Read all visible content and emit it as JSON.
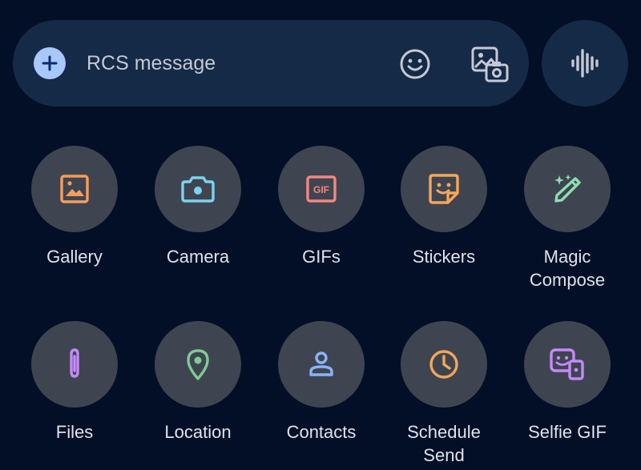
{
  "compose": {
    "placeholder": "RCS message",
    "icons": [
      "plus-icon",
      "emoji-icon",
      "image-camera-icon",
      "voice-waveform-icon"
    ]
  },
  "attachments": {
    "row1": [
      {
        "label": "Gallery",
        "icon": "gallery-icon",
        "color": "#f59e5b"
      },
      {
        "label": "Camera",
        "icon": "camera-icon",
        "color": "#7ad3f0"
      },
      {
        "label": "GIFs",
        "icon": "gif-icon",
        "color": "#f2877f"
      },
      {
        "label": "Stickers",
        "icon": "sticker-icon",
        "color": "#f5a65b"
      },
      {
        "label": "Magic\nCompose",
        "icon": "magic-pen-icon",
        "color": "#8fdcb4"
      }
    ],
    "row2": [
      {
        "label": "Files",
        "icon": "paperclip-icon",
        "color": "#c58af9"
      },
      {
        "label": "Location",
        "icon": "location-pin-icon",
        "color": "#81c995"
      },
      {
        "label": "Contacts",
        "icon": "contact-icon",
        "color": "#8ab4f8"
      },
      {
        "label": "Schedule\nSend",
        "icon": "clock-icon",
        "color": "#f5a65b"
      },
      {
        "label": "Selfie GIF",
        "icon": "selfie-gif-icon",
        "color": "#c58af9"
      }
    ]
  }
}
